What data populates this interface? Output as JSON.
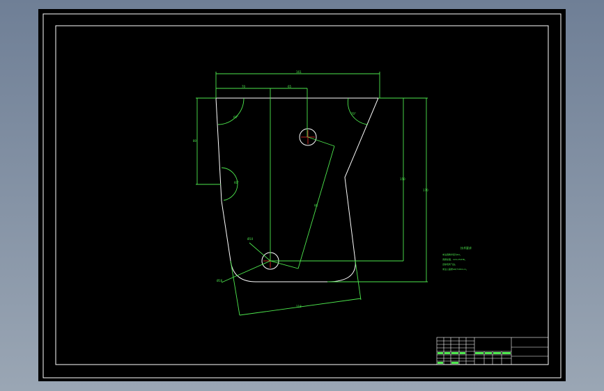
{
  "drawing": {
    "tech_requirements_title": "技术要求",
    "notes": [
      "未注圆角半径为R2。",
      "调质处理，220-250HB。",
      "去除毛刺飞边。",
      "未注公差按GB/T1804-m。"
    ],
    "dimension_labels": {
      "overall_width": "161",
      "top_left": "70",
      "top_mid": "65",
      "left_height": "80",
      "slant_length": "95",
      "right_inner_height": "150",
      "right_outer_height": "170",
      "bottom_length": "118",
      "diameter_small": "Ø10",
      "diameter_large": "Ø16",
      "angle_top_left": "60°",
      "angle_left_mid": "60°",
      "angle_top_right": "70°"
    }
  },
  "colors": {
    "background": "#000000",
    "border": "#ffffff",
    "dimension": "#4ee84e",
    "centerline": "#ff3030"
  }
}
